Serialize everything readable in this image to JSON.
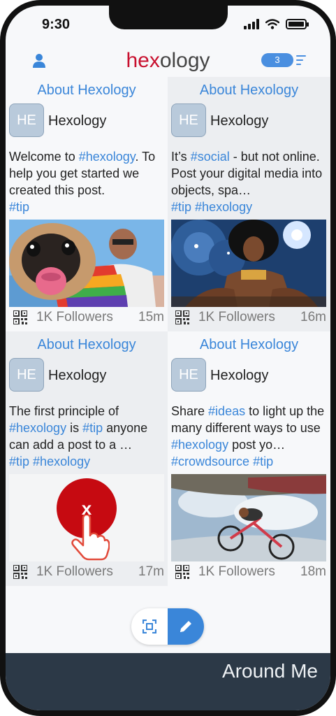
{
  "status": {
    "time": "9:30"
  },
  "header": {
    "logo_part1": "hex",
    "logo_part2": "ology",
    "notification_count": "3",
    "icons": {
      "left": "user-icon",
      "right": "list-menu-icon"
    }
  },
  "cards": [
    {
      "header": "About Hexology",
      "avatar": "HE",
      "name": "Hexology",
      "text": [
        {
          "t": "Welcome to ",
          "tag": false
        },
        {
          "t": "#hexology",
          "tag": true
        },
        {
          "t": ". To help you get started we created this post.",
          "tag": false
        }
      ],
      "tags": [
        "#tip"
      ],
      "media": "pug-photo",
      "followers": "1K Followers",
      "time": "15m"
    },
    {
      "header": "About Hexology",
      "avatar": "HE",
      "name": "Hexology",
      "text": [
        {
          "t": "It’s ",
          "tag": false
        },
        {
          "t": "#social",
          "tag": true
        },
        {
          "t": " - but not online. Post your digital media into objects, spa…",
          "tag": false
        }
      ],
      "tags": [
        "#tip",
        "#hexology"
      ],
      "media": "dancer-photo",
      "followers": "1K Followers",
      "time": "16m"
    },
    {
      "header": "About Hexology",
      "avatar": "HE",
      "name": "Hexology",
      "text": [
        {
          "t": "The first principle of ",
          "tag": false
        },
        {
          "t": "#hexology",
          "tag": true
        },
        {
          "t": " is ",
          "tag": false
        },
        {
          "t": "#tip",
          "tag": true
        },
        {
          "t": " anyone can add a post to a …",
          "tag": false
        }
      ],
      "tags": [
        "#tip",
        "#hexology"
      ],
      "media": "tap-to-close",
      "close_label": "x",
      "followers": "1K Followers",
      "time": "17m"
    },
    {
      "header": "About Hexology",
      "avatar": "HE",
      "name": "Hexology",
      "text": [
        {
          "t": "Share ",
          "tag": false
        },
        {
          "t": "#ideas",
          "tag": true
        },
        {
          "t": " to light up the many different ways to use ",
          "tag": false
        },
        {
          "t": "#hexology",
          "tag": true
        },
        {
          "t": " post yo…",
          "tag": false
        }
      ],
      "tags": [
        "#crowdsource",
        "#tip"
      ],
      "media": "bmx-photo",
      "followers": "1K Followers",
      "time": "18m"
    }
  ],
  "actions": {
    "scan_icon": "scan-icon",
    "edit_icon": "pencil-icon"
  },
  "bottom_bar": {
    "label": "Around Me"
  },
  "colors": {
    "accent": "#3a86d9",
    "brand_red": "#c8102e",
    "bottom_bar": "#2c3947",
    "close_red": "#c60a11"
  }
}
